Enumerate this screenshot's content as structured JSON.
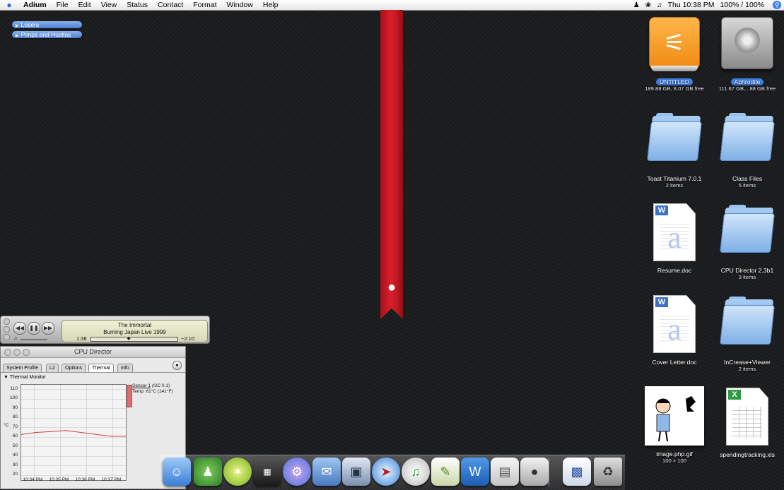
{
  "menubar": {
    "app": "Adium",
    "menus": [
      "File",
      "Edit",
      "View",
      "Status",
      "Contact",
      "Format",
      "Window",
      "Help"
    ],
    "clock": "Thu 10:38 PM",
    "battery": "100% / 100%"
  },
  "contact_groups": [
    "Losers",
    "Pimps and Hustlas"
  ],
  "desktop": {
    "untitled": {
      "name": "UNTITLED",
      "info": "189.88 GB, 8.07 GB free"
    },
    "aphrodite": {
      "name": "Aphrodite",
      "info": "111.67 GB,...88 GB free"
    },
    "toast": {
      "name": "Toast Titanium 7.0.1",
      "info": "2 items"
    },
    "classfiles": {
      "name": "Class Files",
      "info": "5 items"
    },
    "resume": {
      "name": "Resume.doc",
      "info": ""
    },
    "cpudir": {
      "name": "CPU Director 2.3b1",
      "info": "3 items"
    },
    "cover": {
      "name": "Cover Letter.doc",
      "info": ""
    },
    "increase": {
      "name": "InCrease+Viewer",
      "info": "2 items"
    },
    "image": {
      "name": "image.php.gif",
      "info": "100 × 100"
    },
    "spending": {
      "name": "spendingtracking.xls",
      "info": ""
    }
  },
  "itunes": {
    "song": "The Immortal",
    "album": "Burning Japan Live 1999",
    "elapsed": "1:38",
    "remaining": "−2:10",
    "progress": 0.43
  },
  "cpu_director": {
    "title": "CPU Director",
    "tabs": [
      "System Profile",
      "L2",
      "Options",
      "Thermal",
      "Info"
    ],
    "active_tab": "Thermal",
    "section": "Thermal Monitor",
    "unit": "°C",
    "sensor_name": "Sensor 1",
    "sensor_bus": " (I2C 0.1)",
    "sensor_temp": "Temp:  61°C (141°F)",
    "yticks": [
      "110",
      "100",
      "90",
      "80",
      "70",
      "60",
      "50",
      "40",
      "30",
      "20"
    ],
    "xticks": [
      "10:34 PM",
      "10:35 PM",
      "10:36 PM",
      "10:37 PM"
    ]
  },
  "dock_icons": [
    "finder",
    "adium",
    "limewire",
    "powerlogix",
    "gear",
    "mail",
    "iphoto",
    "safari",
    "itunes",
    "textedit",
    "word",
    "preview",
    "system-profiler",
    "screenshot",
    "trash"
  ],
  "chart_data": {
    "type": "line",
    "title": "Thermal Monitor",
    "xlabel": "",
    "ylabel": "°C",
    "ylim": [
      15,
      115
    ],
    "x": [
      "10:34 PM",
      "10:34:30 PM",
      "10:35 PM",
      "10:35:30 PM",
      "10:36 PM",
      "10:36:30 PM",
      "10:37 PM",
      "10:37:30 PM"
    ],
    "series": [
      {
        "values": [
          63,
          65,
          66,
          67,
          65,
          63,
          61,
          61
        ]
      }
    ],
    "grid": true
  }
}
